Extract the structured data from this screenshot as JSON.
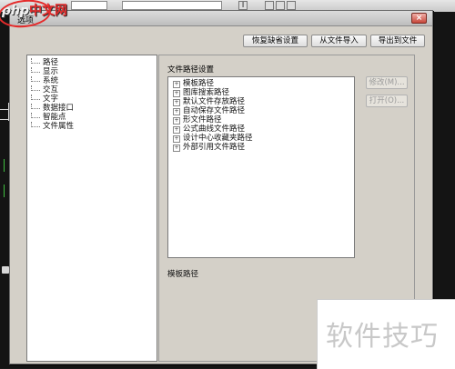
{
  "dialog": {
    "title": "选项",
    "close_label": "×"
  },
  "buttons": {
    "reset": "恢复缺省设置",
    "import": "从文件导入",
    "export": "导出到文件",
    "modify": "修改(M)...",
    "open": "打开(O)..."
  },
  "tree": {
    "items": [
      "路径",
      "显示",
      "系统",
      "交互",
      "文字",
      "数据接口",
      "智能点",
      "文件属性"
    ]
  },
  "file_paths": {
    "label": "文件路径设置",
    "items": [
      "模板路径",
      "图库搜索路径",
      "默认文件存放路径",
      "自动保存文件路径",
      "形文件路径",
      "公式曲线文件路径",
      "设计中心收藏夹路径",
      "外部引用文件路径"
    ],
    "selected_path_label": "模板路径"
  },
  "overlay": {
    "logo_php": "php",
    "logo_cn": "中文网",
    "watermark": "软件技巧"
  },
  "colors": {
    "accent": "#e52b2b",
    "dialog_bg": "#d4d0c8"
  }
}
